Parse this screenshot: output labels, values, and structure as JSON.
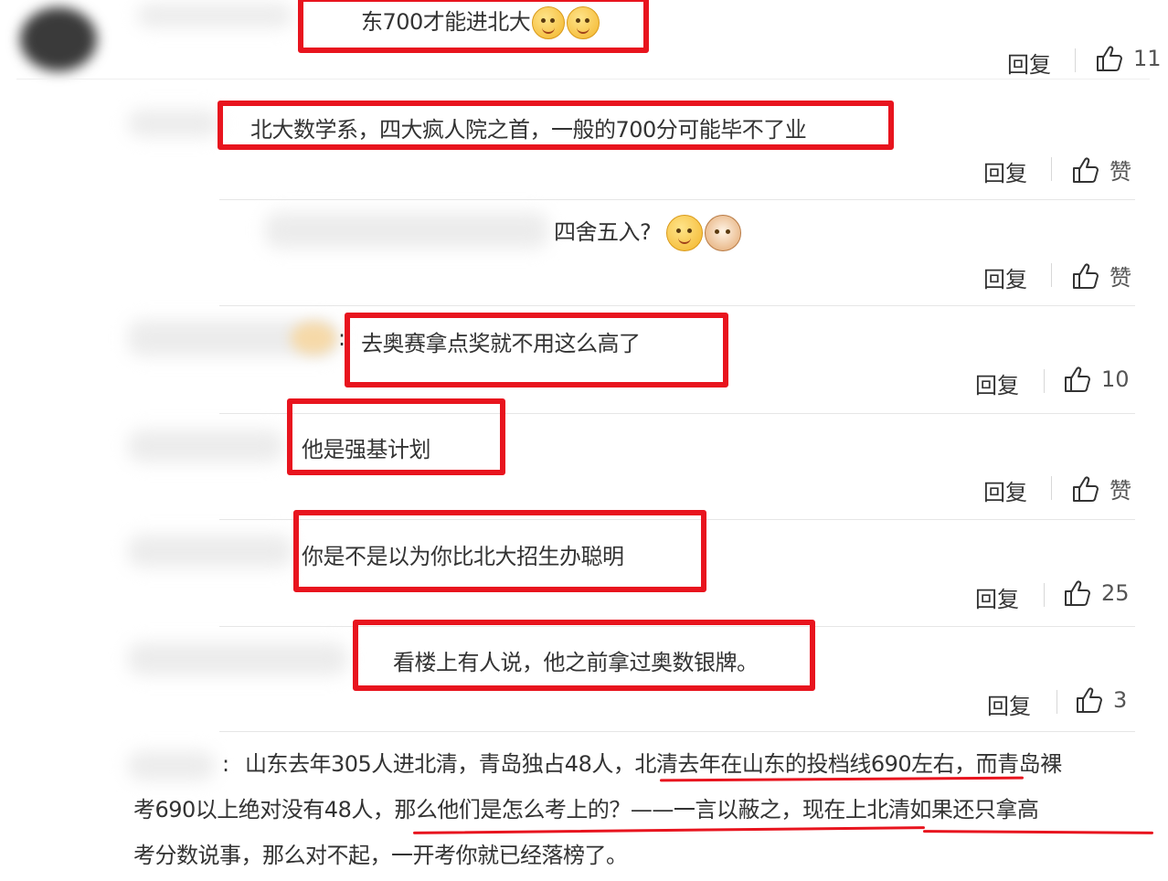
{
  "comments": [
    {
      "text": "东700才能进北大",
      "emoji": [
        "smile-icon",
        "smile-icon"
      ],
      "reply": "回复",
      "likes": "11"
    },
    {
      "text": "北大数学系，四大疯人院之首，一般的700分可能毕不了业",
      "reply": "回复",
      "likes": "赞"
    },
    {
      "text": "四舍五入?",
      "emoji": [
        "grin-icon",
        "cat-icon"
      ],
      "reply": "回复",
      "likes": "赞"
    },
    {
      "prefix": ":",
      "text": "去奥赛拿点奖就不用这么高了",
      "reply": "回复",
      "likes": "10"
    },
    {
      "text": "他是强基计划",
      "reply": "回复",
      "likes": "赞"
    },
    {
      "text": "你是不是以为你比北大招生办聪明",
      "reply": "回复",
      "likes": "25"
    },
    {
      "text": "看楼上有人说，他之前拿过奥数银牌。",
      "reply": "回复",
      "likes": "3"
    }
  ],
  "long_comment": {
    "prefix": ":",
    "line1": "山东去年305人进北清，青岛独占48人，北清去年在山东的投档线690左右，而青岛裸",
    "line2": "考690以上绝对没有48人，那么他们是怎么考上的？——一言以蔽之，现在上北清如果还只拿高",
    "line3": "考分数说事，那么对不起，一开考你就已经落榜了。"
  },
  "colors": {
    "highlight": "#e8141e",
    "text": "#333333",
    "divider": "#e6e6e6"
  }
}
